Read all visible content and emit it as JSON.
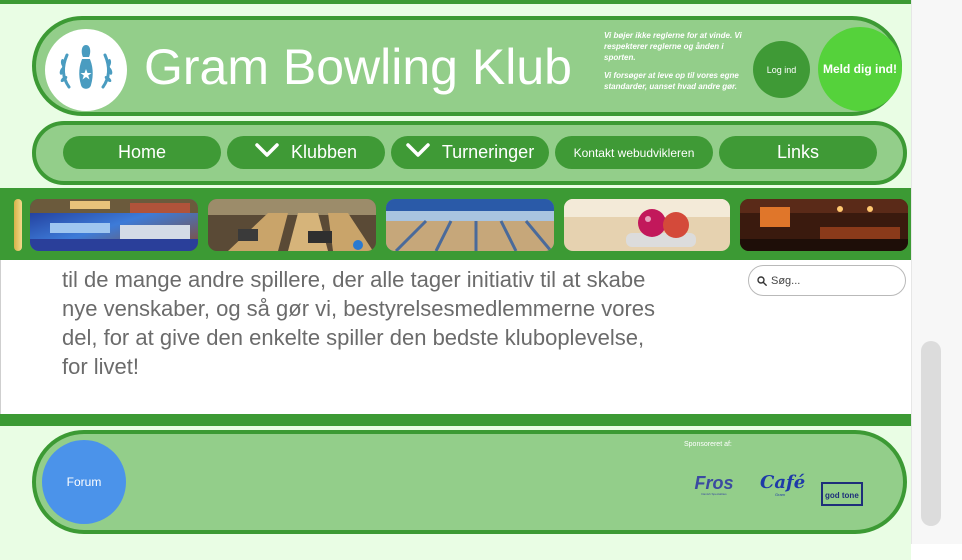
{
  "header": {
    "logo_icon": "bowling-pin-laurel-icon",
    "title": "Gram Bowling Klub",
    "motto_line1": "Vi bøjer ikke reglerne for at vinde. Vi respekterer reglerne og ånden i sporten.",
    "motto_line2": "Vi forsøger at leve op til vores egne standarder, uanset hvad andre gør.",
    "login_label": "Log ind",
    "signup_label": "Meld dig ind!"
  },
  "nav": {
    "items": [
      {
        "label": "Home"
      },
      {
        "label": "Klubben",
        "icon": "chevron-down-icon"
      },
      {
        "label": "Turneringer",
        "icon": "chevron-down-icon"
      },
      {
        "label": "Kontakt webudvikleren"
      },
      {
        "label": "Links"
      }
    ]
  },
  "gallery": {
    "images": [
      "bowling-lounge-photo",
      "bowling-lanes-photo",
      "bowling-alley-photo",
      "bowling-balls-photo",
      "bowling-bar-photo"
    ]
  },
  "content": {
    "paragraph_lines": [
      "til de mange andre spillere, der alle tager initiativ til at skabe",
      "nye venskaber, og så gør vi, bestyrelsesmedlemmerne vores",
      "del, for at give den enkelte spiller den bedste kluboplevelse,",
      "for livet!"
    ]
  },
  "search": {
    "placeholder": "Søg...",
    "icon": "search-icon"
  },
  "footer": {
    "forum_label": "Forum",
    "sponsored_label": "Sponsoreret af:",
    "sponsors": [
      {
        "name": "Fros",
        "sub": "Danish Specialities"
      },
      {
        "name": "Café",
        "sub": "Gram"
      },
      {
        "name": "god tone"
      }
    ]
  },
  "colors": {
    "dark_green": "#3c9a34",
    "light_green": "#93ce8a",
    "bright_green": "#55d23b",
    "forum_blue": "#4b93ea",
    "page_background": "#e9fde4"
  }
}
